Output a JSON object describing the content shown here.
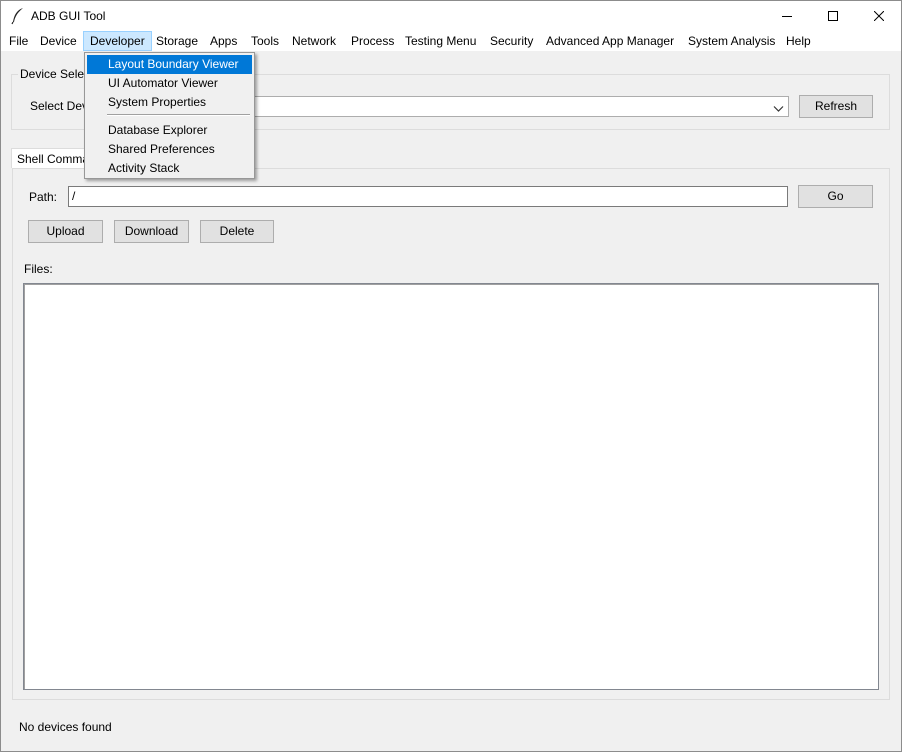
{
  "window": {
    "title": "ADB GUI Tool",
    "controls": {
      "minimize": "minimize-icon",
      "maximize": "maximize-icon",
      "close": "close-icon"
    }
  },
  "menubar": {
    "items": [
      "File",
      "Device",
      "Developer",
      "Storage",
      "Apps",
      "Tools",
      "Network",
      "Process",
      "Testing Menu",
      "Security",
      "Advanced App Manager",
      "System Analysis",
      "Help"
    ],
    "active": "Developer"
  },
  "developer_menu": {
    "items": [
      "Layout Boundary Viewer",
      "UI Automator Viewer",
      "System Properties",
      "Database Explorer",
      "Shared Preferences",
      "Activity Stack"
    ],
    "highlighted": "Layout Boundary Viewer"
  },
  "device_selection": {
    "frame_title": "Device Selection",
    "label": "Select Device:",
    "selected_value": "",
    "refresh_label": "Refresh"
  },
  "shell_tab": {
    "tab_label": "Shell Commands",
    "path_label": "Path:",
    "path_value": "/",
    "go_label": "Go",
    "upload_label": "Upload",
    "download_label": "Download",
    "delete_label": "Delete",
    "files_label": "Files:",
    "files": []
  },
  "status_bar": {
    "text": "No devices found"
  },
  "colors": {
    "window_bg": "#f0f0f0",
    "menu_highlight": "#0078d7",
    "menubar_active_bg": "#cce8ff"
  }
}
